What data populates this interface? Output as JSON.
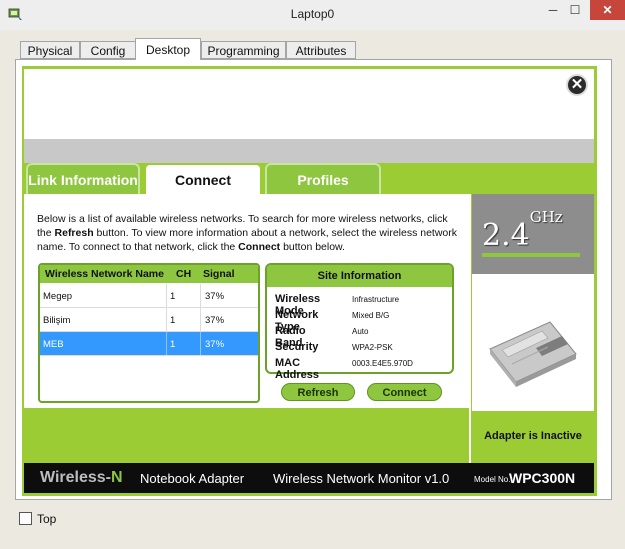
{
  "window": {
    "title": "Laptop0",
    "min_glyph": "─",
    "max_glyph": "☐",
    "close_glyph": "✕"
  },
  "tabs": [
    {
      "label": "Physical"
    },
    {
      "label": "Config"
    },
    {
      "label": "Desktop"
    },
    {
      "label": "Programming"
    },
    {
      "label": "Attributes"
    }
  ],
  "active_tab": "Desktop",
  "pc_wireless": {
    "close_glyph": "✕",
    "subtabs": [
      {
        "label": "Link Information"
      },
      {
        "label": "Connect"
      },
      {
        "label": "Profiles"
      }
    ],
    "active_subtab": "Connect",
    "instructions": {
      "p1": "Below is a list of available wireless networks. To search for more wireless networks, click the ",
      "refresh_word": "Refresh",
      "p2": " button. To view more information about a network, select the wireless network name. To connect to that network, click the ",
      "connect_word": "Connect",
      "p3": " button below."
    },
    "network_table": {
      "headers": {
        "name": "Wireless Network Name",
        "ch": "CH",
        "signal": "Signal"
      },
      "rows": [
        {
          "name": "Megep",
          "ch": "1",
          "signal": "37%"
        },
        {
          "name": "Bilişim",
          "ch": "1",
          "signal": "37%"
        },
        {
          "name": "MEB",
          "ch": "1",
          "signal": "37%"
        }
      ],
      "selected_index": 2
    },
    "site_info": {
      "title": "Site Information",
      "fields": [
        {
          "label": "Wireless Mode",
          "value": "Infrastructure"
        },
        {
          "label": "Network Type",
          "value": "Mixed B/G"
        },
        {
          "label": "Radio Band",
          "value": "Auto"
        },
        {
          "label": "Security",
          "value": "WPA2-PSK"
        },
        {
          "label": "MAC Address",
          "value": "0003.E4E5.970D"
        }
      ]
    },
    "buttons": {
      "refresh": "Refresh",
      "connect": "Connect"
    },
    "side": {
      "ghz_number": "2.4",
      "ghz_unit": "GHz",
      "status": "Adapter is Inactive",
      "card_image": "wireless-card-image"
    },
    "footer": {
      "brand_prefix": "Wireless-",
      "brand_n": "N",
      "adapter": "Notebook Adapter",
      "monitor": "Wireless Network Monitor  v1.0",
      "model_no_label": "Model No.",
      "model": "WPC300N"
    }
  },
  "top_checkbox": {
    "label": "Top",
    "checked": false
  },
  "colors": {
    "green": "#9ccc33",
    "tab_green": "#8ec63f",
    "selected_row": "#3399ff",
    "footer_bg": "#0d0d0d",
    "close_red": "#c7463c"
  }
}
